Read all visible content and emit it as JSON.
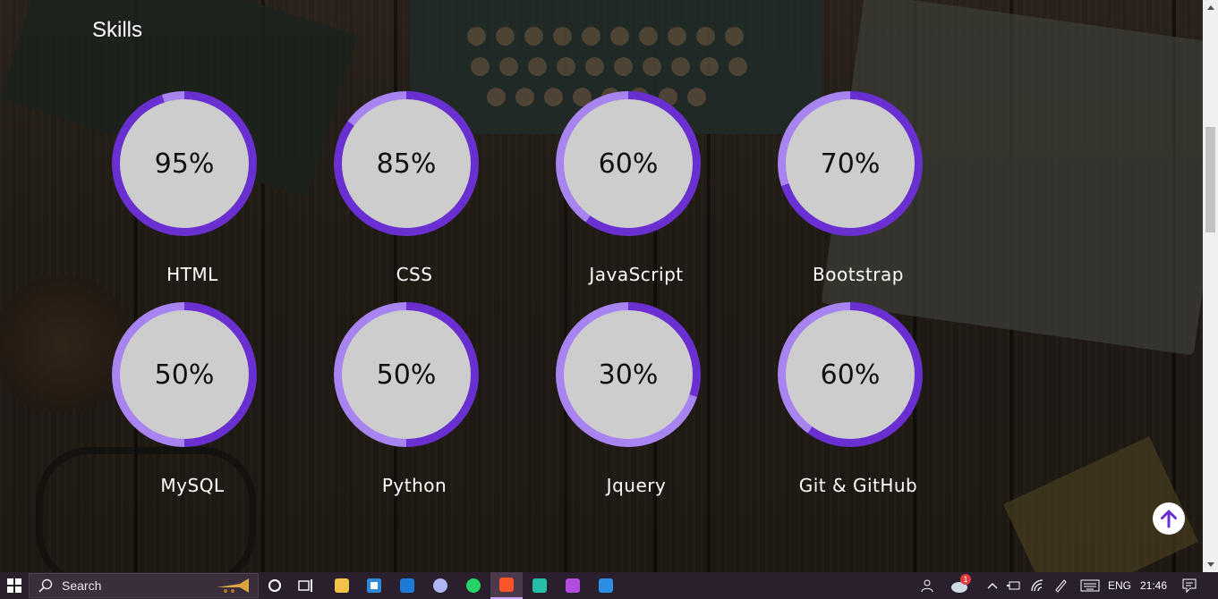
{
  "section": {
    "title": "Skills"
  },
  "skills": [
    {
      "name": "HTML",
      "percent_label": "95%",
      "level": 95
    },
    {
      "name": "CSS",
      "percent_label": "85%",
      "level": 85
    },
    {
      "name": "JavaScript",
      "percent_label": "60%",
      "level": 60
    },
    {
      "name": "Bootstrap",
      "percent_label": "70%",
      "level": 70
    },
    {
      "name": "MySQL",
      "percent_label": "50%",
      "level": 50
    },
    {
      "name": "Python",
      "percent_label": "50%",
      "level": 50
    },
    {
      "name": "Jquery",
      "percent_label": "30%",
      "level": 30
    },
    {
      "name": "Git & GitHub",
      "percent_label": "60%",
      "level": 60
    }
  ],
  "colors": {
    "ring_fill": "#6a2fd0",
    "ring_track": "#a884f0",
    "inner": "#cdcdcd",
    "back_top_arrow": "#6a2fd0"
  },
  "back_to_top": {
    "icon": "arrow-up-icon"
  },
  "taskbar": {
    "search_label": "Search",
    "apps": [
      "task-view",
      "file-explorer",
      "microsoft-store",
      "mail",
      "messenger",
      "whatsapp",
      "brave",
      "vs-code-insiders",
      "proton",
      "vs-code"
    ],
    "notification_count": "1",
    "language": "ENG",
    "time": "21:46"
  }
}
